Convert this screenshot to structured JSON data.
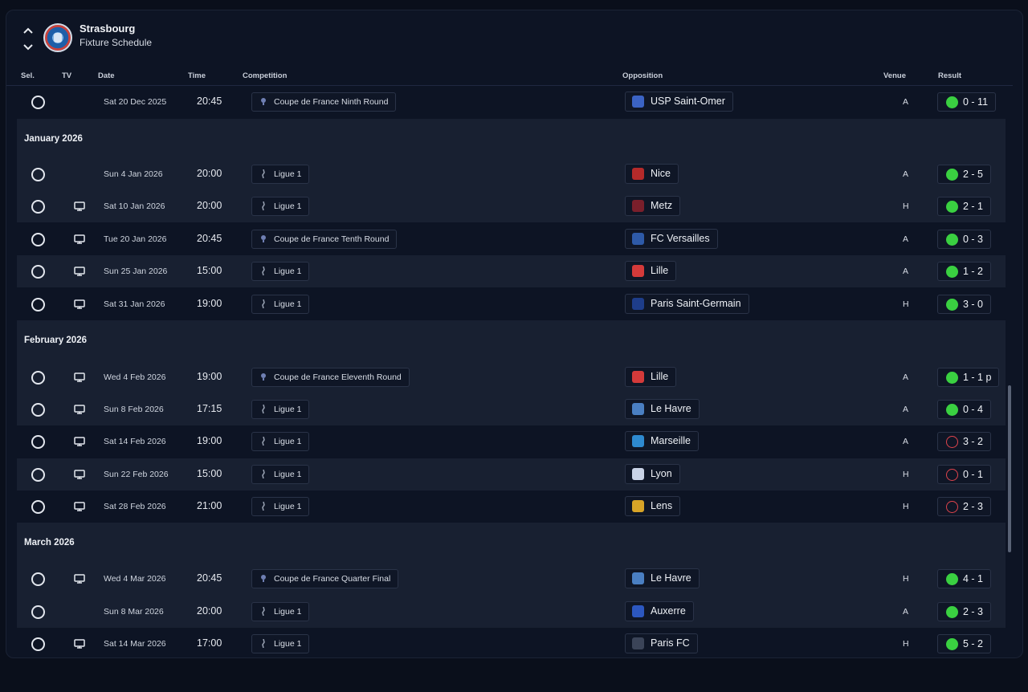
{
  "header": {
    "club": "Strasbourg",
    "subtitle": "Fixture Schedule"
  },
  "columns": {
    "sel": "Sel.",
    "tv": "TV",
    "date": "Date",
    "time": "Time",
    "competition": "Competition",
    "opposition": "Opposition",
    "venue": "Venue",
    "result": "Result"
  },
  "colors": {
    "win": "#3ad041",
    "loss": "#e0444d",
    "background": "#0d1424",
    "row_alt": "#182031"
  },
  "rows": [
    {
      "tv": false,
      "date": "Sat 20 Dec 2025",
      "time": "20:45",
      "competition": "Coupe de France Ninth Round",
      "comp_icon": "coupe-de-france-icon",
      "opposition": "USP Saint-Omer",
      "opp_icon": "saint-omer-crest-icon",
      "venue": "A",
      "result": "0 - 11",
      "outcome": "win"
    },
    {
      "tv": false,
      "date": "Sun 4 Jan 2026",
      "time": "20:00",
      "competition": "Ligue 1",
      "comp_icon": "ligue1-icon",
      "opposition": "Nice",
      "opp_icon": "nice-crest-icon",
      "venue": "A",
      "result": "2 - 5",
      "outcome": "win"
    },
    {
      "tv": true,
      "date": "Sat 10 Jan 2026",
      "time": "20:00",
      "competition": "Ligue 1",
      "comp_icon": "ligue1-icon",
      "opposition": "Metz",
      "opp_icon": "metz-crest-icon",
      "venue": "H",
      "result": "2 - 1",
      "outcome": "win"
    },
    {
      "tv": true,
      "date": "Tue 20 Jan 2026",
      "time": "20:45",
      "competition": "Coupe de France Tenth Round",
      "comp_icon": "coupe-de-france-icon",
      "opposition": "FC Versailles",
      "opp_icon": "versailles-crest-icon",
      "venue": "A",
      "result": "0 - 3",
      "outcome": "win"
    },
    {
      "tv": true,
      "date": "Sun 25 Jan 2026",
      "time": "15:00",
      "competition": "Ligue 1",
      "comp_icon": "ligue1-icon",
      "opposition": "Lille",
      "opp_icon": "lille-crest-icon",
      "venue": "A",
      "result": "1 - 2",
      "outcome": "win"
    },
    {
      "tv": true,
      "date": "Sat 31 Jan 2026",
      "time": "19:00",
      "competition": "Ligue 1",
      "comp_icon": "ligue1-icon",
      "opposition": "Paris Saint-Germain",
      "opp_icon": "psg-crest-icon",
      "venue": "H",
      "result": "3 - 0",
      "outcome": "win"
    },
    {
      "tv": true,
      "date": "Wed 4 Feb 2026",
      "time": "19:00",
      "competition": "Coupe de France Eleventh Round",
      "comp_icon": "coupe-de-france-icon",
      "opposition": "Lille",
      "opp_icon": "lille-crest-icon",
      "venue": "A",
      "result": "1 - 1 p",
      "outcome": "win"
    },
    {
      "tv": true,
      "date": "Sun 8 Feb 2026",
      "time": "17:15",
      "competition": "Ligue 1",
      "comp_icon": "ligue1-icon",
      "opposition": "Le Havre",
      "opp_icon": "le-havre-crest-icon",
      "venue": "A",
      "result": "0 - 4",
      "outcome": "win"
    },
    {
      "tv": true,
      "date": "Sat 14 Feb 2026",
      "time": "19:00",
      "competition": "Ligue 1",
      "comp_icon": "ligue1-icon",
      "opposition": "Marseille",
      "opp_icon": "marseille-crest-icon",
      "venue": "A",
      "result": "3 - 2",
      "outcome": "loss"
    },
    {
      "tv": true,
      "date": "Sun 22 Feb 2026",
      "time": "15:00",
      "competition": "Ligue 1",
      "comp_icon": "ligue1-icon",
      "opposition": "Lyon",
      "opp_icon": "lyon-crest-icon",
      "venue": "H",
      "result": "0 - 1",
      "outcome": "loss"
    },
    {
      "tv": true,
      "date": "Sat 28 Feb 2026",
      "time": "21:00",
      "competition": "Ligue 1",
      "comp_icon": "ligue1-icon",
      "opposition": "Lens",
      "opp_icon": "lens-crest-icon",
      "venue": "H",
      "result": "2 - 3",
      "outcome": "loss"
    },
    {
      "tv": true,
      "date": "Wed 4 Mar 2026",
      "time": "20:45",
      "competition": "Coupe de France Quarter Final",
      "comp_icon": "coupe-de-france-icon",
      "opposition": "Le Havre",
      "opp_icon": "le-havre-crest-icon",
      "venue": "H",
      "result": "4 - 1",
      "outcome": "win"
    },
    {
      "tv": false,
      "date": "Sun 8 Mar 2026",
      "time": "20:00",
      "competition": "Ligue 1",
      "comp_icon": "ligue1-icon",
      "opposition": "Auxerre",
      "opp_icon": "auxerre-crest-icon",
      "venue": "A",
      "result": "2 - 3",
      "outcome": "win"
    },
    {
      "tv": true,
      "date": "Sat 14 Mar 2026",
      "time": "17:00",
      "competition": "Ligue 1",
      "comp_icon": "ligue1-icon",
      "opposition": "Paris FC",
      "opp_icon": "paris-fc-crest-icon",
      "venue": "H",
      "result": "5 - 2",
      "outcome": "win"
    }
  ],
  "months": [
    "January 2026",
    "February 2026",
    "March 2026"
  ]
}
